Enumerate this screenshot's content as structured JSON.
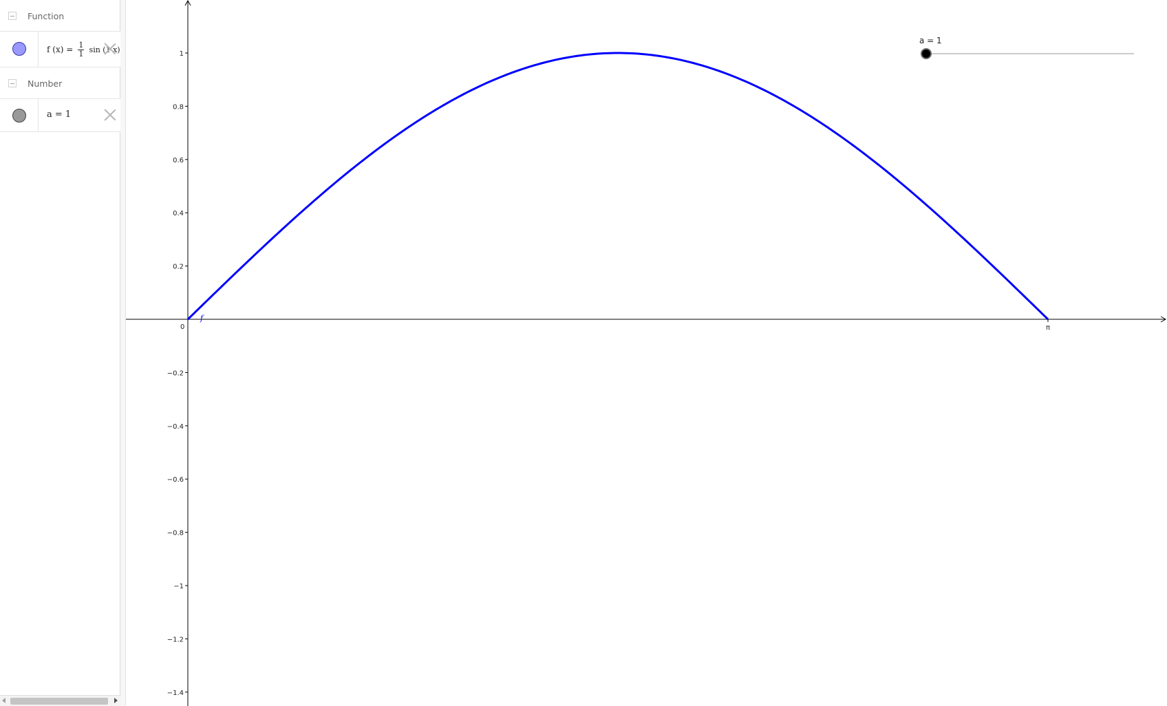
{
  "algebra": {
    "groups": [
      {
        "title": "Function",
        "items": [
          {
            "expr_prefix": "f (x)  =",
            "frac_num": "1",
            "frac_den": "1",
            "expr_suffix": "sin (1 x)",
            "marble_color": "#9999ff"
          }
        ]
      },
      {
        "title": "Number",
        "items": [
          {
            "expr": "a  =  1",
            "marble_color": "#999999"
          }
        ]
      }
    ]
  },
  "graphics": {
    "curve_color": "#0000ff",
    "function_label": "f",
    "origin_label": "0",
    "x_tick_pi_label": "π",
    "y_ticks": [
      {
        "value": 1,
        "label": "1"
      },
      {
        "value": 0.8,
        "label": "0.8"
      },
      {
        "value": 0.6,
        "label": "0.6"
      },
      {
        "value": 0.4,
        "label": "0.4"
      },
      {
        "value": 0.2,
        "label": "0.2"
      },
      {
        "value": -0.2,
        "label": "−0.2"
      },
      {
        "value": -0.4,
        "label": "−0.4"
      },
      {
        "value": -0.6,
        "label": "−0.6"
      },
      {
        "value": -0.8,
        "label": "−0.8"
      },
      {
        "value": -1,
        "label": "−1"
      },
      {
        "value": -1.2,
        "label": "−1.2"
      },
      {
        "value": -1.4,
        "label": "−1.4"
      }
    ],
    "slider": {
      "label": "a = 1",
      "value": 1,
      "min": 1,
      "max": 10
    }
  }
}
